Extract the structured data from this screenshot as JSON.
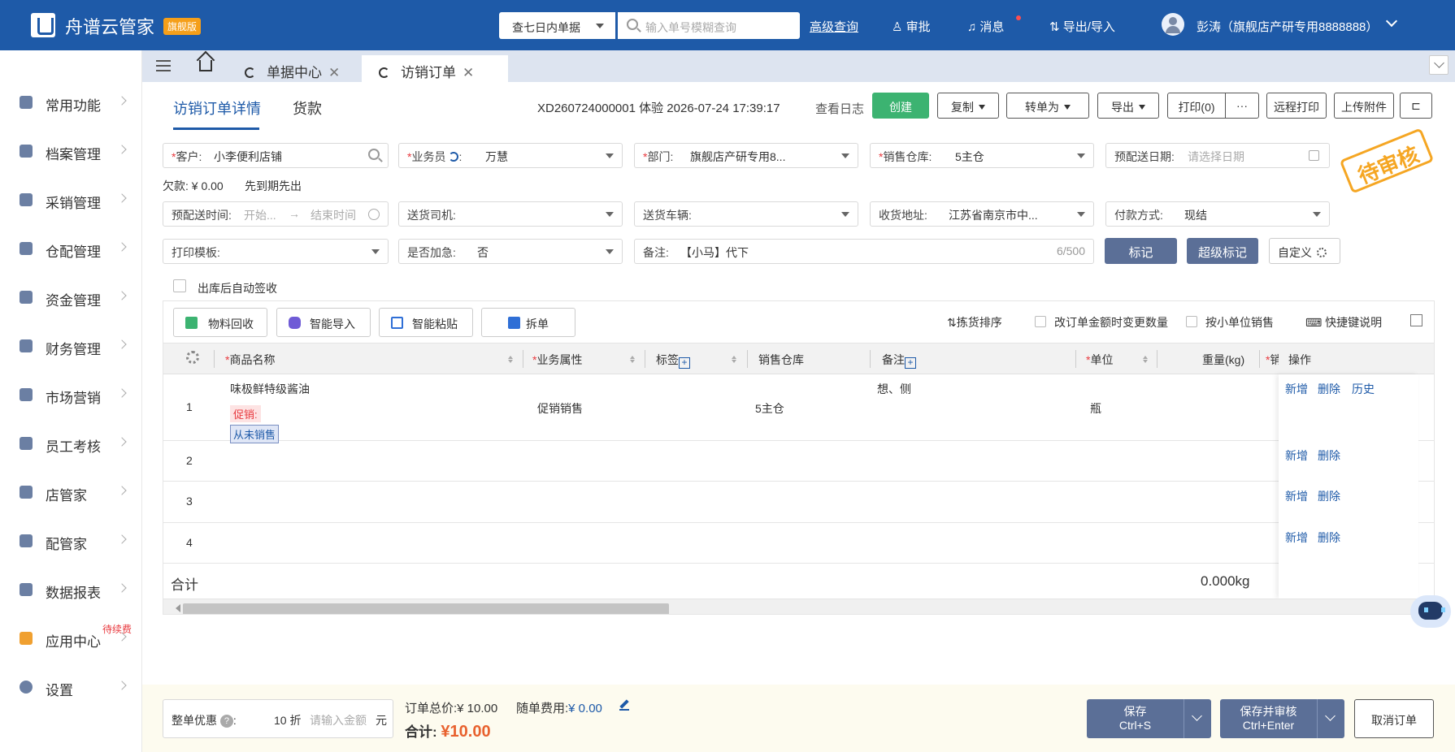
{
  "header": {
    "app_name": "舟谱云管家",
    "edition": "旗舰版",
    "query_range": "查七日内单据",
    "search_placeholder": "输入单号模糊查询",
    "advanced_search": "高级查询",
    "approve": "审批",
    "messages": "消息",
    "export_import": "导出/导入",
    "user": "彭涛（旗舰店产研专用8888888）"
  },
  "sidebar": {
    "items": [
      {
        "label": "常用功能",
        "icon": "star-icon"
      },
      {
        "label": "档案管理",
        "icon": "grid-icon"
      },
      {
        "label": "采销管理",
        "icon": "doc-icon"
      },
      {
        "label": "仓配管理",
        "icon": "warehouse-icon"
      },
      {
        "label": "资金管理",
        "icon": "money-icon"
      },
      {
        "label": "财务管理",
        "icon": "calculator-icon"
      },
      {
        "label": "市场营销",
        "icon": "shop-icon"
      },
      {
        "label": "员工考核",
        "icon": "people-icon"
      },
      {
        "label": "店管家",
        "icon": "store-icon"
      },
      {
        "label": "配管家",
        "icon": "delivery-icon"
      },
      {
        "label": "数据报表",
        "icon": "chart-icon"
      },
      {
        "label": "应用中心",
        "icon": "apps-icon",
        "badge": "待续费"
      },
      {
        "label": "设置",
        "icon": "gear-icon"
      }
    ]
  },
  "tabs": [
    {
      "label": "单据中心"
    },
    {
      "label": "访销订单"
    }
  ],
  "subtabs": {
    "detail": "访销订单详情",
    "payment": "货款"
  },
  "order": {
    "number": "XD260724000001",
    "meta": "体验 2026-07-24 17:39:17",
    "log": "查看日志"
  },
  "actions": {
    "create": "创建",
    "copy": "复制",
    "convert": "转单为",
    "export": "导出",
    "print": "打印(0)",
    "more": "···",
    "remote_print": "远程打印",
    "upload": "上传附件"
  },
  "status_stamp": "待审核",
  "form": {
    "customer_label": "客户:",
    "customer": "小李便利店铺",
    "salesman_label": "业务员",
    "salesman": "万慧",
    "dept_label": "部门:",
    "dept": "旗舰店产研专用8...",
    "warehouse_label": "销售仓库:",
    "warehouse": "5主仓",
    "delivery_date_label": "预配送日期:",
    "delivery_date_ph": "请选择日期",
    "debt": "欠款: ¥ 0.00",
    "fifo": "先到期先出",
    "delivery_time_label": "预配送时间:",
    "time_start": "开始...",
    "time_arrow": "→",
    "time_end": "结束时间",
    "driver_label": "送货司机:",
    "vehicle_label": "送货车辆:",
    "address_label": "收货地址:",
    "address": "江苏省南京市中...",
    "pay_label": "付款方式:",
    "pay": "现结",
    "template_label": "打印模板:",
    "urgent_label": "是否加急:",
    "urgent": "否",
    "remark_label": "备注:",
    "remark": "【小马】代下",
    "remark_count": "6/500",
    "mark": "标记",
    "super_mark": "超级标记",
    "custom": "自定义",
    "auto_sign": "出库后自动签收"
  },
  "toolbar": {
    "recycle": "物料回收",
    "smart_import": "智能导入",
    "smart_paste": "智能粘贴",
    "split": "拆单",
    "pick_sort": "拣货排序",
    "amount_change": "改订单金额时变更数量",
    "small_unit": "按小单位销售",
    "shortcut": "快捷键说明"
  },
  "table": {
    "headers": {
      "product": "商品名称",
      "biz": "业务属性",
      "tag": "标签",
      "wh": "销售仓库",
      "remark": "备注",
      "unit": "单位",
      "weight": "重量(kg)",
      "cut": "销",
      "ops": "操作"
    },
    "rows": [
      {
        "no": "1",
        "product": "味极鲜特级酱油",
        "promo": "促销:",
        "never": "从未销售",
        "biz": "促销销售",
        "wh": "5主仓",
        "remark": "想、侧",
        "unit": "瓶"
      },
      {
        "no": "2"
      },
      {
        "no": "3"
      },
      {
        "no": "4"
      }
    ],
    "op_add": "新增",
    "op_del": "删除",
    "op_hist": "历史",
    "total_label": "合计",
    "total_weight": "0.000kg"
  },
  "footer": {
    "discount_label": "整单优惠",
    "discount_help": "?",
    "discount_colon": ":",
    "discount_value": "10 折",
    "discount_ph": "请输入金额",
    "yuan": "元",
    "order_total_label": "订单总价:",
    "order_total": "¥ 10.00",
    "fee_label": "随单费用:",
    "fee": "¥ 0.00",
    "sum_label": "合计:",
    "sum": "¥10.00",
    "save": "保存",
    "save_key": "Ctrl+S",
    "save_audit": "保存并审核",
    "save_audit_key": "Ctrl+Enter",
    "cancel": "取消订单"
  }
}
